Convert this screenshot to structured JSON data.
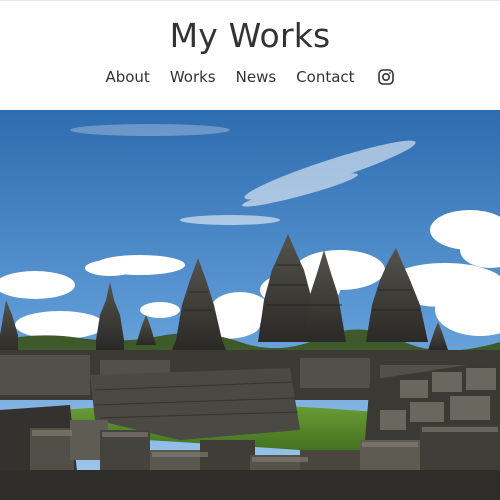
{
  "site": {
    "title": "My Works"
  },
  "nav": {
    "items": [
      {
        "label": "About"
      },
      {
        "label": "Works"
      },
      {
        "label": "News"
      },
      {
        "label": "Contact"
      }
    ],
    "social_icon": "instagram-icon"
  },
  "hero": {
    "image_alt": "",
    "colors": {
      "sky_top": "#2f6fb3",
      "sky_bottom": "#8fc0ea",
      "stone_dark": "#2b2b29",
      "stone_mid": "#4b4a45",
      "stone_light": "#7a776d",
      "grass": "#5b8f2e"
    }
  }
}
